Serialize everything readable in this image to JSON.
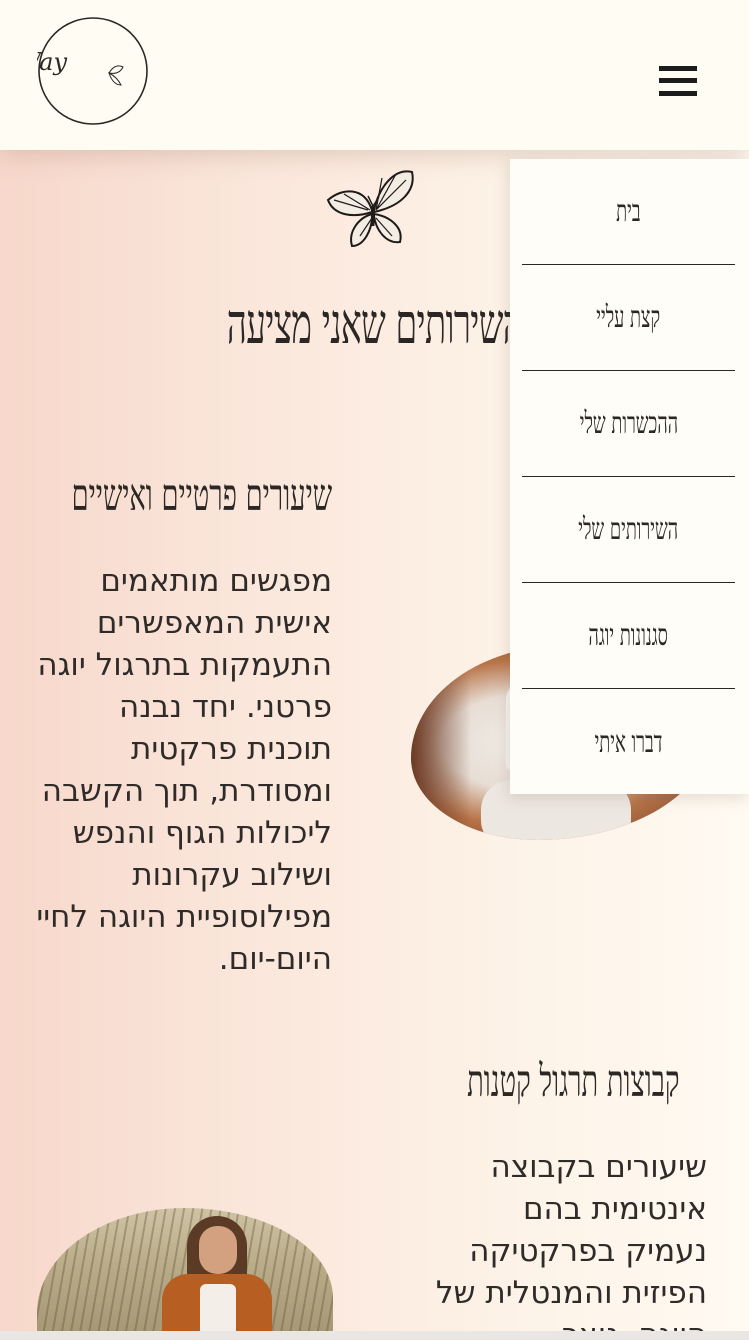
{
  "header": {
    "logo_text": "M Way",
    "menu_icon": "hamburger-menu-icon"
  },
  "page": {
    "section_title": "השירותים שאני מציעה",
    "decor_icon": "butterfly-icon"
  },
  "services": [
    {
      "title": "שיעורים פרטיים ואישיים",
      "text": "מפגשים מותאמים אישית המאפשרים התעמקות בתרגול יוגה פרטני. יחד נבנה תוכנית פרקטית ומסודרת, תוך הקשבה ליכולות הגוף והנפש ושילוב עקרונות מפילוסופיית היוגה לחיי היום-יום."
    },
    {
      "title": "קבוצות תרגול קטנות",
      "text": "שיעורים בקבוצה אינטימית בהם נעמיק בפרקטיקה הפיזית והמנטלית של היוגה, נוצר"
    }
  ],
  "menu": {
    "items": [
      {
        "label": "בית"
      },
      {
        "label": "קצת עליי"
      },
      {
        "label": "ההכשרות שלי"
      },
      {
        "label": "השירותים שלי"
      },
      {
        "label": "סגנונות יוגה"
      },
      {
        "label": "דברו איתי"
      }
    ]
  },
  "colors": {
    "header_bg": "#fffcf4",
    "text": "#2b2725",
    "gradient_left": "#f7d8cb",
    "gradient_right": "#fffaf2"
  }
}
